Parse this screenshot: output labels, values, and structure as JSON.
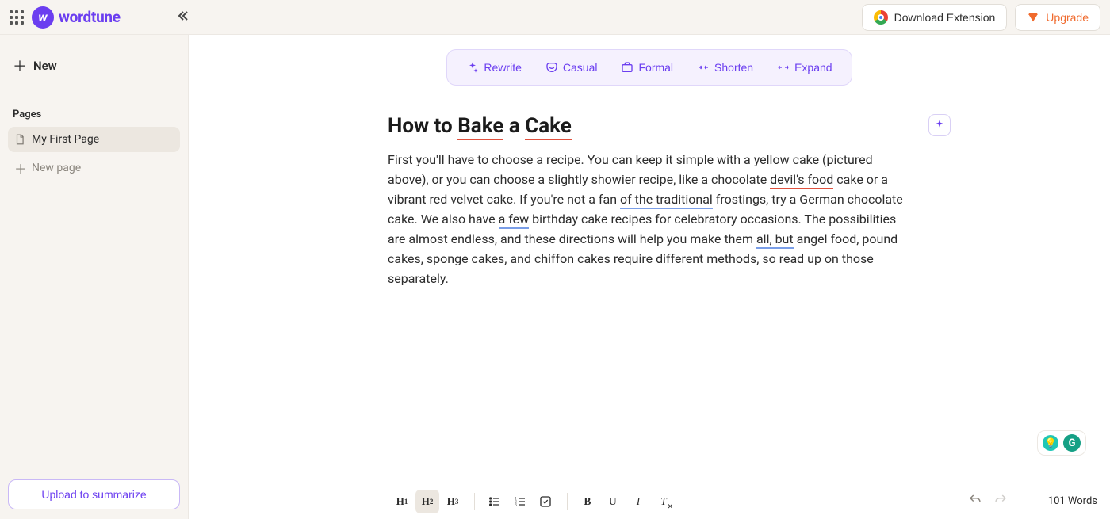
{
  "header": {
    "brand": "wordtune",
    "download_ext": "Download Extension",
    "upgrade": "Upgrade"
  },
  "sidebar": {
    "new_label": "New",
    "section_label": "Pages",
    "items": [
      {
        "label": "My First Page",
        "active": true
      }
    ],
    "new_page_label": "New page",
    "upload_label": "Upload to summarize"
  },
  "toolbar": {
    "rewrite": "Rewrite",
    "casual": "Casual",
    "formal": "Formal",
    "shorten": "Shorten",
    "expand": "Expand"
  },
  "document": {
    "title_pre": "How to ",
    "title_sp1": "Bake",
    "title_mid": " a ",
    "title_sp2": "Cake",
    "p1": "First you'll have to choose a recipe. You can keep it simple with a yellow cake (pictured above), or you can choose a slightly showier recipe, like a chocolate ",
    "sp_devils": "devil's food",
    "p2": " cake or a vibrant red velvet cake. If you're not a fan ",
    "gr_trad": "of the traditional",
    "p3": " frostings, try a German chocolate cake. We also have ",
    "gr_afew": "a few",
    "p4": " birthday cake recipes for celebratory occasions. The possibilities are almost endless, and these directions will help you make them ",
    "gr_allbut": "all, but",
    "p5": " angel food, pound cakes, sponge cakes, and chiffon cakes require different methods, so read up on those separately."
  },
  "format": {
    "h1": "H",
    "h1s": "1",
    "h2": "H",
    "h2s": "2",
    "h3": "H",
    "h3s": "3"
  },
  "footer": {
    "word_count": "101 Words"
  }
}
